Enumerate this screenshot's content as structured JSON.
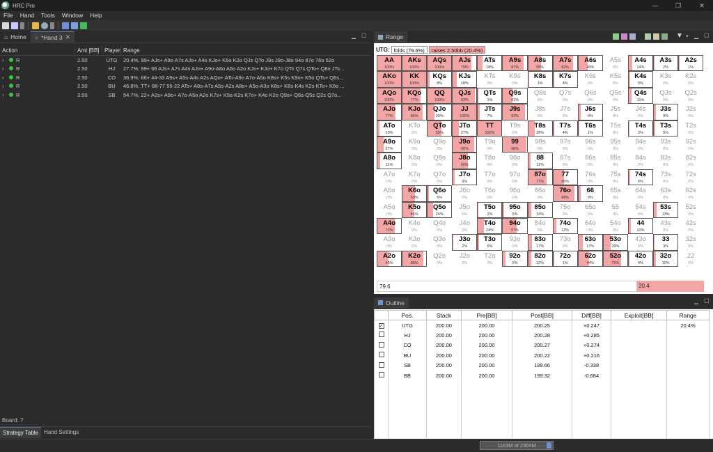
{
  "window": {
    "title": "HRC Pro"
  },
  "menu": [
    "File",
    "Hand",
    "Tools",
    "Window",
    "Help"
  ],
  "tabs": [
    {
      "label": "Home"
    },
    {
      "label": "*Hand 3"
    }
  ],
  "actions_table": {
    "columns": [
      "Action",
      "Amt [BB]",
      "Player",
      "Range"
    ],
    "rows": [
      {
        "action": "R",
        "amt": "2.50",
        "player": "UTG",
        "range": "20.4%, 99+ AJs+ A9s-A7s AJo+ A4o KJo+ K6o K2o QJs QTo J9s J9o-J8o 94o 87o 76o 52o"
      },
      {
        "action": "R",
        "amt": "2.50",
        "player": "HJ",
        "range": "27.7%, 99+ 66 AJs+ A7s A4s AJo+ A9o-A8o A6o A2o KJs+ KJo+ K7o QTs Q7s QTo+ Q8o JTs..."
      },
      {
        "action": "R",
        "amt": "2.50",
        "player": "CO",
        "range": "36.9%, 66+ 44-33 A9s+ A5s-A4s A2s AQo+ ATo-A9o A7o-A5o K8s+ K5s K9o+ K5o QTs+ Q6s..."
      },
      {
        "action": "R",
        "amt": "2.50",
        "player": "BU",
        "range": "46.8%, TT+ 88-77 55-22 ATs+ A8s-A7s A5s-A2s A8o+ A5o-A3o K8s+ K6s-K4s K2s KTo+ K6o ..."
      },
      {
        "action": "R",
        "amt": "3.50",
        "player": "SB",
        "range": "54.7%, 22+ A2s+ A9o+ A7o-A5o A2o K7s+ K5s-K2s K7o+ K4o K2o Q9s+ Q6s-Q5s Q2s Q7o..."
      }
    ]
  },
  "board_label": "Board: ?",
  "bottom_tabs": [
    "Strategy Table",
    "Hand Settings"
  ],
  "range_panel": {
    "tab_label": "Range",
    "player": "UTG:",
    "folds_label": "folds (79.6%)",
    "raises_label": "raises 2.50bb (20.4%)",
    "fold_value": "79.6",
    "raise_value": "20.4",
    "raise_color": "#f4a6a6",
    "grid": [
      [
        [
          "AA",
          "100%"
        ],
        [
          "AKs",
          "100%"
        ],
        [
          "AQs",
          "100%"
        ],
        [
          "AJs",
          "79%"
        ],
        [
          "ATs",
          "18%"
        ],
        [
          "A9s",
          "87%"
        ],
        [
          "A8s",
          "55%"
        ],
        [
          "A7s",
          "82%"
        ],
        [
          "A6s",
          "40%"
        ],
        [
          "A5s",
          "0%"
        ],
        [
          "A4s",
          "14%"
        ],
        [
          "A3s",
          "2%"
        ],
        [
          "A2s",
          "1%"
        ]
      ],
      [
        [
          "AKo",
          "100%"
        ],
        [
          "KK",
          "100%"
        ],
        [
          "KQs",
          "8%"
        ],
        [
          "KJs",
          "18%"
        ],
        [
          "KTs",
          "0%"
        ],
        [
          "K9s",
          "0%"
        ],
        [
          "K8s",
          "1%"
        ],
        [
          "K7s",
          "4%"
        ],
        [
          "K6s",
          "0%"
        ],
        [
          "K5s",
          "0%"
        ],
        [
          "K4s",
          "5%"
        ],
        [
          "K3s",
          "0%"
        ],
        [
          "K2s",
          "0%"
        ]
      ],
      [
        [
          "AQo",
          "100%"
        ],
        [
          "KQo",
          "77%"
        ],
        [
          "QQ",
          "100%"
        ],
        [
          "QJs",
          "93%"
        ],
        [
          "QTs",
          "1%"
        ],
        [
          "Q9s",
          "41%"
        ],
        [
          "Q8s",
          "0%"
        ],
        [
          "Q7s",
          "0%"
        ],
        [
          "Q6s",
          "0%"
        ],
        [
          "Q5s",
          "0%"
        ],
        [
          "Q4s",
          "11%"
        ],
        [
          "Q3s",
          "0%"
        ],
        [
          "Q2s",
          "0%"
        ]
      ],
      [
        [
          "AJo",
          "77%"
        ],
        [
          "KJo",
          "85%"
        ],
        [
          "QJo",
          "29%"
        ],
        [
          "JJ",
          "100%"
        ],
        [
          "JTs",
          "7%"
        ],
        [
          "J9s",
          "92%"
        ],
        [
          "J8s",
          "0%"
        ],
        [
          "J7s",
          "0%"
        ],
        [
          "J6s",
          "9%"
        ],
        [
          "J5s",
          "0%"
        ],
        [
          "J4s",
          "0%"
        ],
        [
          "J3s",
          "9%"
        ],
        [
          "J2s",
          "0%"
        ]
      ],
      [
        [
          "ATo",
          "10%"
        ],
        [
          "KTo",
          "0%"
        ],
        [
          "QTo",
          "59%"
        ],
        [
          "JTo",
          "27%"
        ],
        [
          "TT",
          "100%"
        ],
        [
          "T9s",
          "0%"
        ],
        [
          "T8s",
          "28%"
        ],
        [
          "T7s",
          "4%"
        ],
        [
          "T6s",
          "1%"
        ],
        [
          "T5s",
          "0%"
        ],
        [
          "T4s",
          "2%"
        ],
        [
          "T3s",
          "5%"
        ],
        [
          "T2s",
          "0%"
        ]
      ],
      [
        [
          "A9o",
          "27%"
        ],
        [
          "K9o",
          "0%"
        ],
        [
          "Q9o",
          "0%"
        ],
        [
          "J9o",
          "90%"
        ],
        [
          "T9o",
          "0%"
        ],
        [
          "99",
          "98%"
        ],
        [
          "98s",
          "0%"
        ],
        [
          "97s",
          "0%"
        ],
        [
          "96s",
          "0%"
        ],
        [
          "95s",
          "0%"
        ],
        [
          "94s",
          "0%"
        ],
        [
          "93s",
          "0%"
        ],
        [
          "92s",
          "0%"
        ]
      ],
      [
        [
          "A8o",
          "11%"
        ],
        [
          "K8o",
          "0%"
        ],
        [
          "Q8o",
          "0%"
        ],
        [
          "J8o",
          "65%"
        ],
        [
          "T8o",
          "0%"
        ],
        [
          "98o",
          "0%"
        ],
        [
          "88",
          "11%"
        ],
        [
          "87s",
          "0%"
        ],
        [
          "86s",
          "0%"
        ],
        [
          "85s",
          "0%"
        ],
        [
          "84s",
          "0%"
        ],
        [
          "83s",
          "0%"
        ],
        [
          "82s",
          "0%"
        ]
      ],
      [
        [
          "A7o",
          "0%"
        ],
        [
          "K7o",
          "0%"
        ],
        [
          "Q7o",
          "0%"
        ],
        [
          "J7o",
          "9%"
        ],
        [
          "T7o",
          "0%"
        ],
        [
          "97o",
          "0%"
        ],
        [
          "87o",
          "77%"
        ],
        [
          "77",
          "45%"
        ],
        [
          "76s",
          "0%"
        ],
        [
          "75s",
          "0%"
        ],
        [
          "74s",
          "6%"
        ],
        [
          "73s",
          "0%"
        ],
        [
          "72s",
          "0%"
        ]
      ],
      [
        [
          "A6o",
          "0%"
        ],
        [
          "K6o",
          "53%"
        ],
        [
          "Q6o",
          "6%"
        ],
        [
          "J6o",
          "0%"
        ],
        [
          "T6o",
          "0%"
        ],
        [
          "96o",
          "0%"
        ],
        [
          "86o",
          "0%"
        ],
        [
          "76o",
          "88%"
        ],
        [
          "66",
          "9%"
        ],
        [
          "65s",
          "0%"
        ],
        [
          "64s",
          "0%"
        ],
        [
          "63s",
          "0%"
        ],
        [
          "62s",
          "0%"
        ]
      ],
      [
        [
          "A5o",
          "0%"
        ],
        [
          "K5o",
          "46%"
        ],
        [
          "Q5o",
          "24%"
        ],
        [
          "J5o",
          "0%"
        ],
        [
          "T5o",
          "2%"
        ],
        [
          "95o",
          "5%"
        ],
        [
          "85o",
          "13%"
        ],
        [
          "75o",
          "0%"
        ],
        [
          "65o",
          "0%"
        ],
        [
          "55",
          "0%"
        ],
        [
          "54s",
          "0%"
        ],
        [
          "53s",
          "13%"
        ],
        [
          "52s",
          "0%"
        ]
      ],
      [
        [
          "A4o",
          "72%"
        ],
        [
          "K4o",
          "0%"
        ],
        [
          "Q4o",
          "0%"
        ],
        [
          "J4o",
          "0%"
        ],
        [
          "T4o",
          "24%"
        ],
        [
          "94o",
          "57%"
        ],
        [
          "84o",
          "0%"
        ],
        [
          "74o",
          "12%"
        ],
        [
          "64o",
          "0%"
        ],
        [
          "54o",
          "0%"
        ],
        [
          "44",
          "10%"
        ],
        [
          "43s",
          "0%"
        ],
        [
          "42s",
          "0%"
        ]
      ],
      [
        [
          "A3o",
          "0%"
        ],
        [
          "K3o",
          "0%"
        ],
        [
          "Q3o",
          "0%"
        ],
        [
          "J3o",
          "2%"
        ],
        [
          "T3o",
          "6%"
        ],
        [
          "93o",
          "0%"
        ],
        [
          "83o",
          "17%"
        ],
        [
          "73o",
          "0%"
        ],
        [
          "63o",
          "17%"
        ],
        [
          "53o",
          "29%"
        ],
        [
          "43o",
          "0%"
        ],
        [
          "33",
          "3%"
        ],
        [
          "32s",
          "0%"
        ]
      ],
      [
        [
          "A2o",
          "46%"
        ],
        [
          "K2o",
          "88%"
        ],
        [
          "Q2o",
          "0%"
        ],
        [
          "J2o",
          "0%"
        ],
        [
          "T2o",
          "0%"
        ],
        [
          "92o",
          "9%"
        ],
        [
          "82o",
          "12%"
        ],
        [
          "72o",
          "1%"
        ],
        [
          "62o",
          "44%"
        ],
        [
          "52o",
          "75%"
        ],
        [
          "42o",
          "4%"
        ],
        [
          "32o",
          "10%"
        ],
        [
          "22",
          "0%"
        ]
      ]
    ]
  },
  "outline": {
    "tab_label": "Outline",
    "columns": [
      "Pos.",
      "Stack",
      "Pre[BB]",
      "Post[BB]",
      "Diff[BB]",
      "Exploit[BB]",
      "Range"
    ],
    "rows": [
      {
        "checked": true,
        "pos": "UTG",
        "stack": "200.00",
        "pre": "200.00",
        "post": "200.25",
        "diff": "+0.247",
        "exploit": "",
        "range": "20.4%"
      },
      {
        "checked": false,
        "pos": "HJ",
        "stack": "200.00",
        "pre": "200.00",
        "post": "200.28",
        "diff": "+0.285",
        "exploit": "",
        "range": ""
      },
      {
        "checked": false,
        "pos": "CO",
        "stack": "200.00",
        "pre": "200.00",
        "post": "200.27",
        "diff": "+0.274",
        "exploit": "",
        "range": ""
      },
      {
        "checked": false,
        "pos": "BU",
        "stack": "200.00",
        "pre": "200.00",
        "post": "200.22",
        "diff": "+0.216",
        "exploit": "",
        "range": ""
      },
      {
        "checked": false,
        "pos": "SB",
        "stack": "200.00",
        "pre": "200.00",
        "post": "199.66",
        "diff": "-0.338",
        "exploit": "",
        "range": ""
      },
      {
        "checked": false,
        "pos": "BB",
        "stack": "200.00",
        "pre": "200.00",
        "post": "199.32",
        "diff": "-0.684",
        "exploit": "",
        "range": ""
      }
    ]
  },
  "status": {
    "memory": "1163M of 2304M"
  }
}
